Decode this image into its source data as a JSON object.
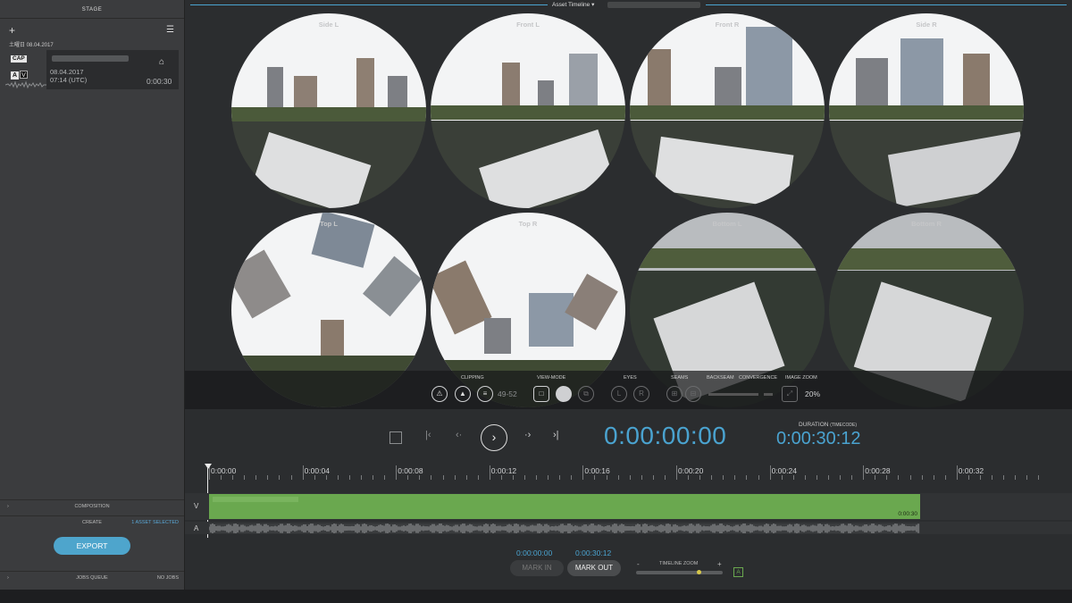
{
  "colors": {
    "accent": "#4aa3d0",
    "video_track": "#6aa84f",
    "panel": "#3b3c3e",
    "background": "#2b2d2f"
  },
  "stage": {
    "header": "STAGE",
    "add_icon": "plus-icon",
    "menu_icon": "hamburger-icon",
    "date_group": "土曜日 08.04.2017",
    "clip": {
      "badge_cap": "CAP",
      "badge_a": "A",
      "badge_v": "V",
      "date": "08.04.2017",
      "time": "07:14 (UTC)",
      "duration": "0:00:30",
      "tag_icon": "tag-icon"
    }
  },
  "left_sections": {
    "composition": "COMPOSITION",
    "create": "CREATE",
    "assets_selected": "1 ASSET SELECTED",
    "export_label": "EXPORT",
    "jobs_queue": "JOBS QUEUE",
    "no_jobs": "NO JOBS"
  },
  "timeline_header": {
    "title": "Asset Timeline",
    "dropdown_icon": "chevron-down-icon"
  },
  "viewer": {
    "lenses": [
      "Side L",
      "Front L",
      "Front R",
      "Side R",
      "Top L",
      "Top R",
      "Bottom L",
      "Bottom R"
    ]
  },
  "toolbar": {
    "clipping_label": "CLIPPING",
    "clipping_value": "49-52",
    "viewmode_label": "VIEW-MODE",
    "eyes_label": "EYES",
    "eye_left": "L",
    "eye_right": "R",
    "seams_label": "SEAMS",
    "backseam_label": "BACKSEAM",
    "convergence_label": "CONVERGENCE",
    "zoom_label": "IMAGE ZOOM",
    "zoom_value": "20%"
  },
  "transport": {
    "current_timecode": "0:00:00:00",
    "duration_label": "DURATION",
    "duration_sub": "(TIMECODE)",
    "duration_timecode": "0:00:30:12",
    "play_icon": "play-icon",
    "stop_icon": "stop-icon",
    "to_start_icon": "skip-to-start-icon",
    "prev_frame_icon": "step-back-icon",
    "next_frame_icon": "step-forward-icon",
    "to_end_icon": "skip-to-end-icon"
  },
  "ruler": {
    "ticks": [
      "0:00:00",
      "0:00:04",
      "0:00:08",
      "0:00:12",
      "0:00:16",
      "0:00:20",
      "0:00:24",
      "0:00:28",
      "0:00:32"
    ]
  },
  "tracks": {
    "video_label": "V",
    "audio_label": "A",
    "video_end": "0:00:30"
  },
  "marks": {
    "in_timecode": "0:00:00:00",
    "out_timecode": "0:00:30:12",
    "mark_in_label": "MARK IN",
    "mark_out_label": "MARK OUT"
  },
  "timeline_zoom": {
    "label": "TIMELINE ZOOM",
    "minus": "-",
    "plus": "+",
    "level": 0.72,
    "audio_badge": "A"
  }
}
